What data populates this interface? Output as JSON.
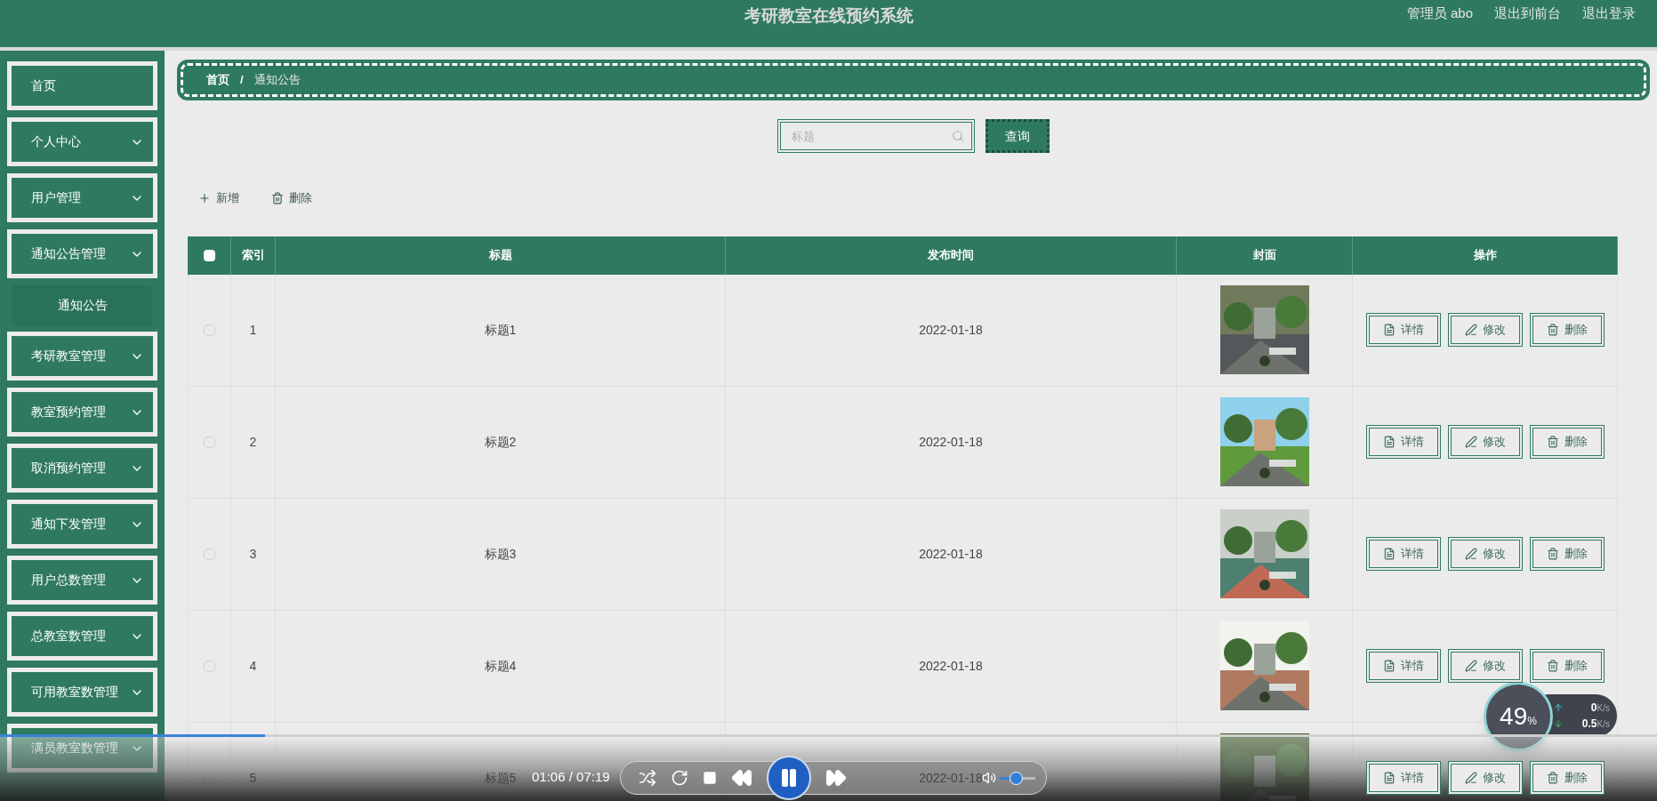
{
  "header": {
    "title": "考研教室在线预约系统",
    "user": "管理员 abo",
    "links": [
      "退出到前台",
      "退出登录"
    ]
  },
  "sidebar": {
    "items": [
      {
        "label": "首页",
        "kind": "link"
      },
      {
        "label": "个人中心",
        "kind": "menu"
      },
      {
        "label": "用户管理",
        "kind": "menu"
      },
      {
        "label": "通知公告管理",
        "kind": "menu",
        "children": [
          {
            "label": "通知公告"
          }
        ]
      },
      {
        "label": "考研教室管理",
        "kind": "menu"
      },
      {
        "label": "教室预约管理",
        "kind": "menu"
      },
      {
        "label": "取消预约管理",
        "kind": "menu"
      },
      {
        "label": "通知下发管理",
        "kind": "menu"
      },
      {
        "label": "用户总数管理",
        "kind": "menu"
      },
      {
        "label": "总教室数管理",
        "kind": "menu"
      },
      {
        "label": "可用教室数管理",
        "kind": "menu"
      },
      {
        "label": "满员教室数管理",
        "kind": "menu"
      }
    ]
  },
  "breadcrumb": {
    "items": [
      "首页",
      "通知公告"
    ],
    "separator": "/"
  },
  "search": {
    "placeholder": "标题",
    "button": "查询"
  },
  "toolbar": [
    {
      "kind": "add",
      "label": "新增"
    },
    {
      "kind": "delete",
      "label": "删除"
    }
  ],
  "table": {
    "all_checked": false,
    "columns": [
      "索引",
      "标题",
      "发布时间",
      "封面",
      "操作"
    ],
    "rows": [
      {
        "checked": false,
        "index": "1",
        "title": "标题1",
        "date": "2022-01-18",
        "actions": [
          {
            "kind": "detail",
            "label": "详情"
          },
          {
            "kind": "edit",
            "label": "修改"
          },
          {
            "kind": "delete",
            "label": "删除"
          }
        ]
      },
      {
        "checked": false,
        "index": "2",
        "title": "标题2",
        "date": "2022-01-18",
        "actions": [
          {
            "kind": "detail",
            "label": "详情"
          },
          {
            "kind": "edit",
            "label": "修改"
          },
          {
            "kind": "delete",
            "label": "删除"
          }
        ]
      },
      {
        "checked": false,
        "index": "3",
        "title": "标题3",
        "date": "2022-01-18",
        "actions": [
          {
            "kind": "detail",
            "label": "详情"
          },
          {
            "kind": "edit",
            "label": "修改"
          },
          {
            "kind": "delete",
            "label": "删除"
          }
        ]
      },
      {
        "checked": false,
        "index": "4",
        "title": "标题4",
        "date": "2022-01-18",
        "actions": [
          {
            "kind": "detail",
            "label": "详情"
          },
          {
            "kind": "edit",
            "label": "修改"
          },
          {
            "kind": "delete",
            "label": "删除"
          }
        ]
      },
      {
        "checked": false,
        "index": "5",
        "title": "标题5",
        "date": "2022-01-18",
        "actions": [
          {
            "kind": "detail",
            "label": "详情"
          },
          {
            "kind": "edit",
            "label": "修改"
          },
          {
            "kind": "delete",
            "label": "删除"
          }
        ]
      }
    ]
  },
  "player": {
    "time": "01:06 / 07:19",
    "playing": true,
    "progress": {
      "level": 0.16
    },
    "volume": {
      "level": 0.45
    }
  },
  "speed_widget": {
    "percent": "49",
    "percent_unit": "%",
    "upload": "0",
    "upload_unit": "K/s",
    "download": "0.5",
    "download_unit": "K/s"
  }
}
